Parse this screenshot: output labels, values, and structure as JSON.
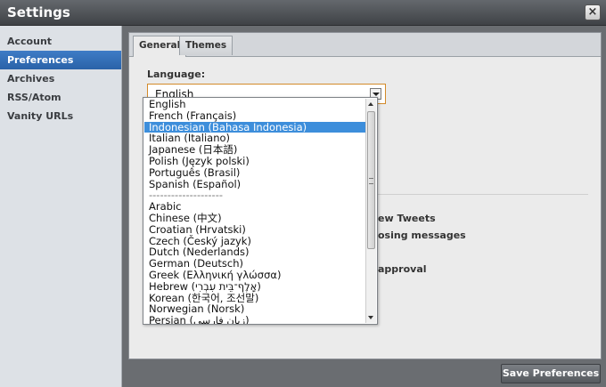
{
  "window": {
    "title": "Settings",
    "close_label": "×"
  },
  "sidebar": {
    "items": [
      {
        "label": "Account"
      },
      {
        "label": "Preferences"
      },
      {
        "label": "Archives"
      },
      {
        "label": "RSS/Atom"
      },
      {
        "label": "Vanity URLs"
      }
    ],
    "selected": "Preferences"
  },
  "tabs": [
    {
      "label": "General"
    },
    {
      "label": "Themes"
    }
  ],
  "language": {
    "label": "Language:",
    "value": "English",
    "options": [
      "English",
      "French (Français)",
      "Indonesian (Bahasa Indonesia)",
      "Italian (Italiano)",
      "Japanese (日本語)",
      "Polish (Język polski)",
      "Português (Brasil)",
      "Spanish (Español)",
      "--------------------",
      "Arabic",
      "Chinese (中文)",
      "Croatian (Hrvatski)",
      "Czech (Český jazyk)",
      "Dutch (Nederlands)",
      "German (Deutsch)",
      "Greek (Ελληνική γλώσσα)",
      "Hebrew (אָלֶף־בֵּית עִבְרִי)",
      "Korean (한국어, 조선말)",
      "Norwegian (Norsk)",
      "Persian (زبان فارسی)"
    ],
    "highlighted": "Indonesian (Bahasa Indonesia)"
  },
  "background_text": {
    "line1": "ew Tweets",
    "line2": "osing messages",
    "line3": "approval"
  },
  "footer": {
    "save_label": "Save Preferences"
  },
  "colors": {
    "accent": "#2a62a8",
    "highlight": "#3d8edb",
    "focus_border": "#d28a2a"
  }
}
